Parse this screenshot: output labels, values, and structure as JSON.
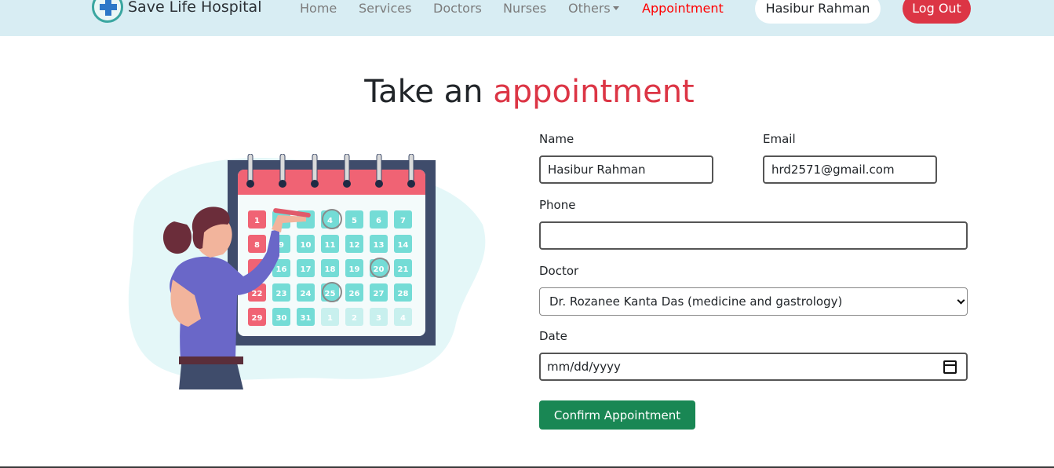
{
  "brand": {
    "name": "Save Life Hospital",
    "logo_icon": "medical-cross-icon"
  },
  "nav": {
    "items": [
      {
        "label": "Home"
      },
      {
        "label": "Services"
      },
      {
        "label": "Doctors"
      },
      {
        "label": "Nurses"
      },
      {
        "label": "Others"
      },
      {
        "label": "Appointment"
      }
    ],
    "user_name": "Hasibur Rahman",
    "logout_label": "Log Out"
  },
  "heading": {
    "prefix": "Take an",
    "accent": "appointment"
  },
  "form": {
    "name_label": "Name",
    "name_value": "Hasibur Rahman",
    "email_label": "Email",
    "email_value": "hrd2571@gmail.com",
    "phone_label": "Phone",
    "phone_value": "",
    "doctor_label": "Doctor",
    "doctor_value": "Dr. Rozanee Kanta Das (medicine and gastrology)",
    "date_label": "Date",
    "date_placeholder": "mm/dd/yyyy",
    "confirm_label": "Confirm Appointment"
  },
  "calendar": {
    "rows": [
      [
        "1",
        "",
        "",
        "4",
        "5",
        "6",
        "7"
      ],
      [
        "8",
        "9",
        "10",
        "11",
        "12",
        "13",
        "14"
      ],
      [
        "",
        "16",
        "17",
        "18",
        "19",
        "20",
        "21"
      ],
      [
        "22",
        "23",
        "24",
        "25",
        "26",
        "27",
        "28"
      ],
      [
        "29",
        "30",
        "31",
        "1",
        "2",
        "3",
        "4"
      ]
    ]
  },
  "colors": {
    "nav_bg": "#d8edf3",
    "accent": "#dc3545",
    "active_nav": "#ff0000",
    "confirm": "#198754"
  }
}
